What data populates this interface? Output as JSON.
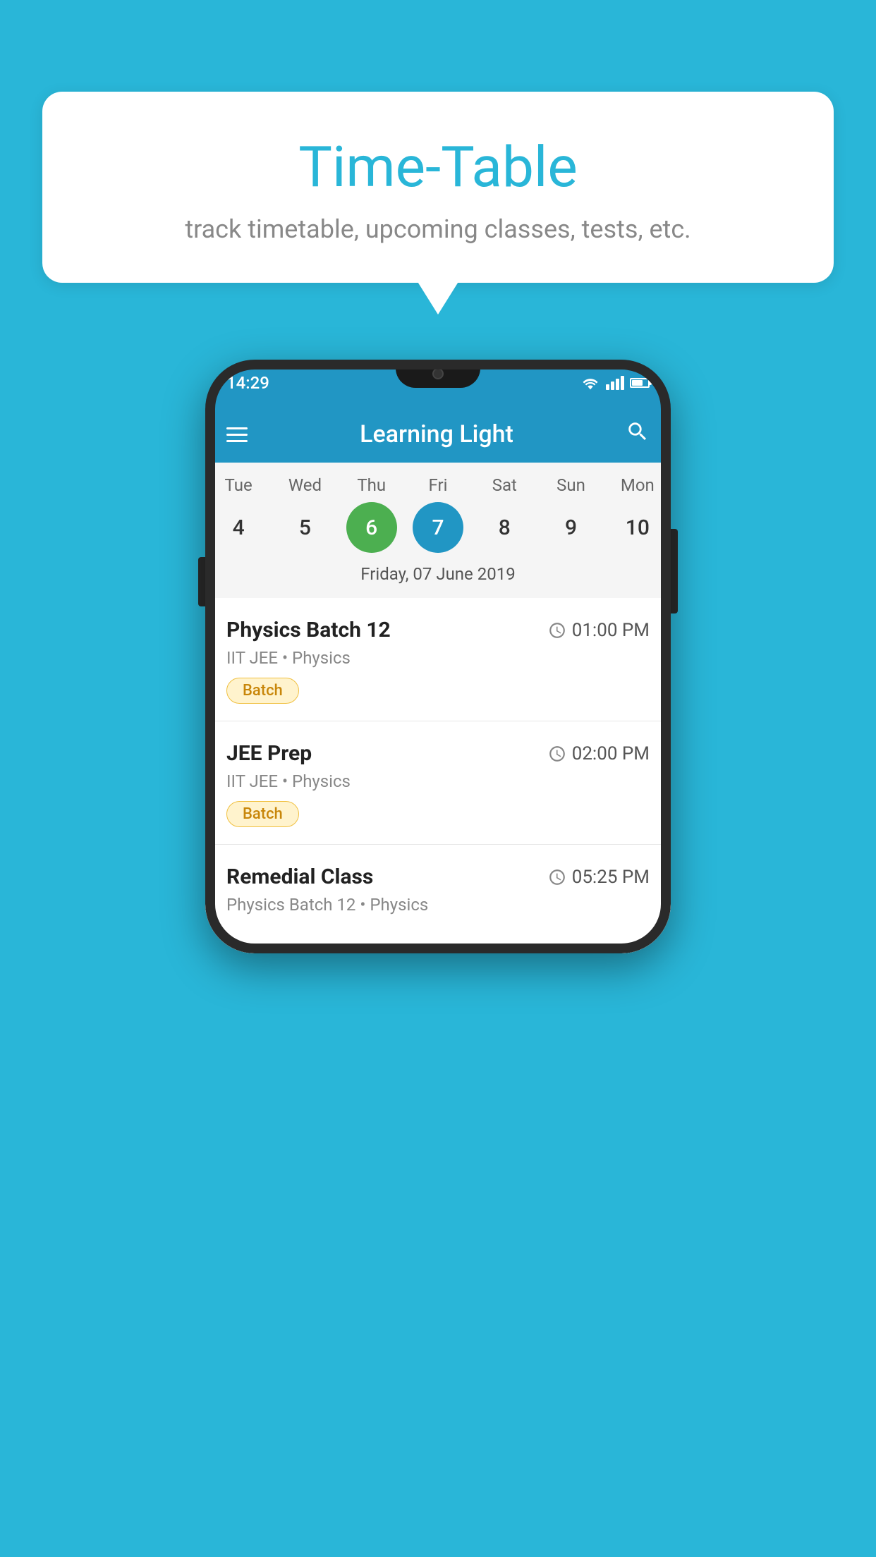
{
  "background_color": "#29B6D8",
  "speech_bubble": {
    "title": "Time-Table",
    "subtitle": "track timetable, upcoming classes, tests, etc."
  },
  "phone": {
    "status_bar": {
      "time": "14:29"
    },
    "app_header": {
      "title": "Learning Light"
    },
    "calendar": {
      "days": [
        "Tue",
        "Wed",
        "Thu",
        "Fri",
        "Sat",
        "Sun",
        "Mon"
      ],
      "dates": [
        4,
        5,
        6,
        7,
        8,
        9,
        10
      ],
      "today_index": 2,
      "selected_index": 3,
      "selected_date_label": "Friday, 07 June 2019"
    },
    "schedule_items": [
      {
        "title": "Physics Batch 12",
        "time": "01:00 PM",
        "subtitle": "IIT JEE • Physics",
        "badge": "Batch"
      },
      {
        "title": "JEE Prep",
        "time": "02:00 PM",
        "subtitle": "IIT JEE • Physics",
        "badge": "Batch"
      },
      {
        "title": "Remedial Class",
        "time": "05:25 PM",
        "subtitle": "Physics Batch 12 • Physics",
        "badge": null
      }
    ]
  }
}
